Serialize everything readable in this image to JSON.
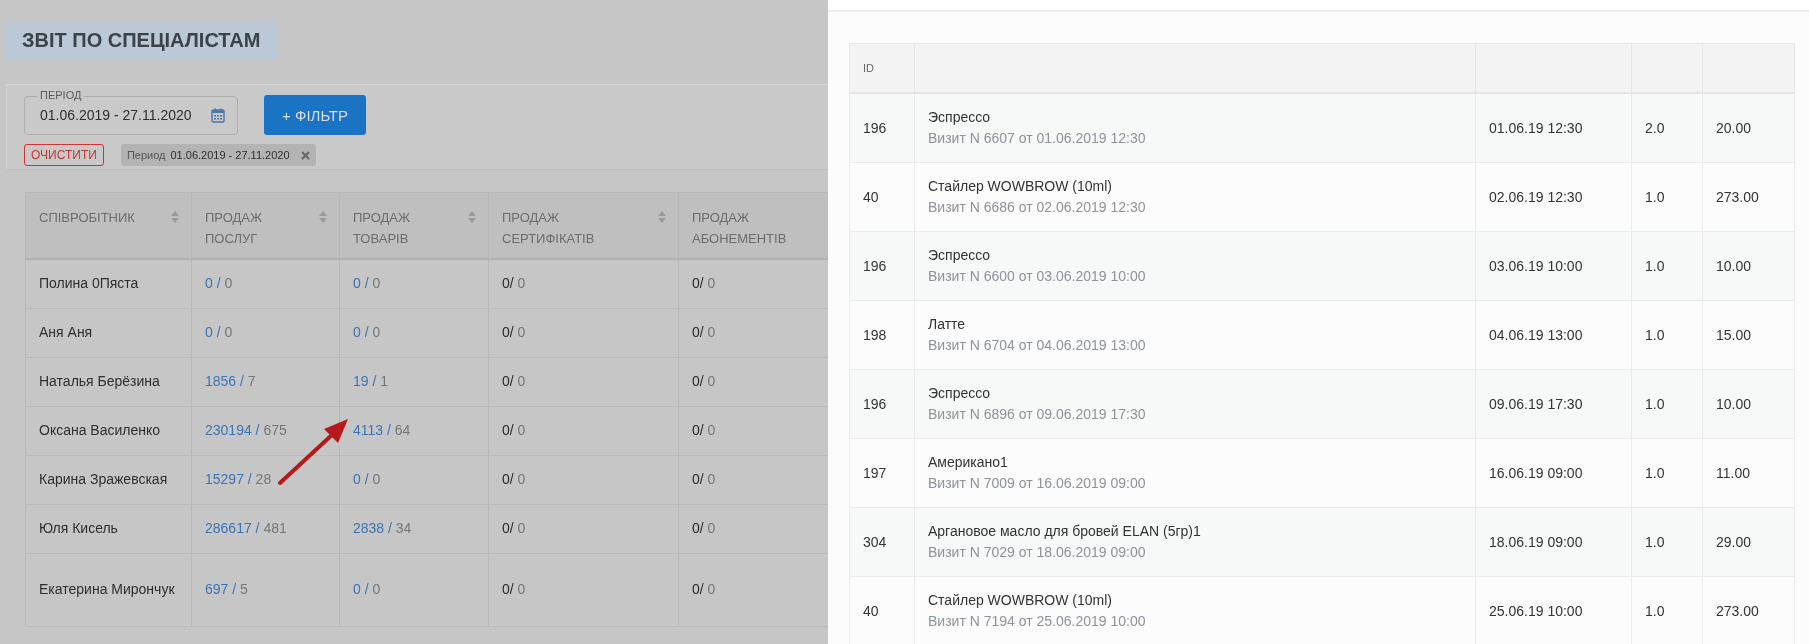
{
  "page_title": "ЗВІТ ПО СПЕЦІАЛІСТАМ",
  "period_field": {
    "label": "ПЕРІОД",
    "value": "01.06.2019 - 27.11.2020"
  },
  "filter_button": "+ ФІЛЬТР",
  "clear_button": "ОЧИСТИТИ",
  "filter_chip": {
    "label": "Период",
    "value": "01.06.2019 - 27.11.2020"
  },
  "report_table": {
    "columns": [
      {
        "label": "СПІВРОБІТНИК",
        "sortable": true
      },
      {
        "label": "ПРОДАЖ ПОСЛУГ",
        "sortable": true
      },
      {
        "label": "ПРОДАЖ ТОВАРІВ",
        "sortable": true
      },
      {
        "label": "ПРОДАЖ СЕРТИФІКАТІВ",
        "sortable": true
      },
      {
        "label": "ПРОДАЖ АБОНЕМЕНТІВ",
        "sortable": false
      }
    ],
    "rows": [
      {
        "cells": [
          {
            "kind": "name",
            "main": "Полина 0Пяста"
          },
          {
            "kind": "link",
            "main": "0 /",
            "count": "0"
          },
          {
            "kind": "link",
            "main": "0 /",
            "count": "0"
          },
          {
            "kind": "plain",
            "main": "0/",
            "count": "0"
          },
          {
            "kind": "plain",
            "main": "0/",
            "count": "0"
          }
        ]
      },
      {
        "cells": [
          {
            "kind": "name",
            "main": "Аня Аня"
          },
          {
            "kind": "link",
            "main": "0 /",
            "count": "0"
          },
          {
            "kind": "link",
            "main": "0 /",
            "count": "0"
          },
          {
            "kind": "plain",
            "main": "0/",
            "count": "0"
          },
          {
            "kind": "plain",
            "main": "0/",
            "count": "0"
          }
        ]
      },
      {
        "cells": [
          {
            "kind": "name",
            "main": "Наталья Берёзина"
          },
          {
            "kind": "link",
            "main": "1856 /",
            "count": "7"
          },
          {
            "kind": "link",
            "main": "19 /",
            "count": "1"
          },
          {
            "kind": "plain",
            "main": "0/",
            "count": "0"
          },
          {
            "kind": "plain",
            "main": "0/",
            "count": "0"
          }
        ]
      },
      {
        "cells": [
          {
            "kind": "name",
            "main": "Оксана Василенко"
          },
          {
            "kind": "link",
            "main": "230194 /",
            "count": "675"
          },
          {
            "kind": "link",
            "main": "4113 /",
            "count": "64"
          },
          {
            "kind": "plain",
            "main": "0/",
            "count": "0"
          },
          {
            "kind": "plain",
            "main": "0/",
            "count": "0"
          }
        ]
      },
      {
        "cells": [
          {
            "kind": "name",
            "main": "Карина Зражевская"
          },
          {
            "kind": "link",
            "main": "15297 /",
            "count": "28"
          },
          {
            "kind": "link",
            "main": "0 /",
            "count": "0"
          },
          {
            "kind": "plain",
            "main": "0/",
            "count": "0"
          },
          {
            "kind": "plain",
            "main": "0/",
            "count": "0"
          }
        ]
      },
      {
        "cells": [
          {
            "kind": "name",
            "main": "Юля Кисель"
          },
          {
            "kind": "link",
            "main": "286617 /",
            "count": "481"
          },
          {
            "kind": "link",
            "main": "2838 /",
            "count": "34"
          },
          {
            "kind": "plain",
            "main": "0/",
            "count": "0"
          },
          {
            "kind": "plain",
            "main": "0/",
            "count": "0"
          }
        ]
      },
      {
        "cells": [
          {
            "kind": "name",
            "main": "Екатерина Мирончук"
          },
          {
            "kind": "link",
            "main": "697 /",
            "count": "5"
          },
          {
            "kind": "link",
            "main": "0 /",
            "count": "0"
          },
          {
            "kind": "plain",
            "main": "0/",
            "count": "0"
          },
          {
            "kind": "plain",
            "main": "0/",
            "count": "0"
          }
        ]
      }
    ]
  },
  "drawer_table": {
    "columns": [
      "ID"
    ],
    "rows": [
      {
        "id": "196",
        "product": "Эспрессо",
        "visit": "Визит N 6607 от 01.06.2019 12:30",
        "date": "01.06.19 12:30",
        "qty": "2.0",
        "sum": "20.00"
      },
      {
        "id": "40",
        "product": "Стайлер WOWBROW (10ml)",
        "visit": "Визит N 6686 от 02.06.2019 12:30",
        "date": "02.06.19 12:30",
        "qty": "1.0",
        "sum": "273.00"
      },
      {
        "id": "196",
        "product": "Эспрессо",
        "visit": "Визит N 6600 от 03.06.2019 10:00",
        "date": "03.06.19 10:00",
        "qty": "1.0",
        "sum": "10.00"
      },
      {
        "id": "198",
        "product": "Латте",
        "visit": "Визит N 6704 от 04.06.2019 13:00",
        "date": "04.06.19 13:00",
        "qty": "1.0",
        "sum": "15.00"
      },
      {
        "id": "196",
        "product": "Эспрессо",
        "visit": "Визит N 6896 от 09.06.2019 17:30",
        "date": "09.06.19 17:30",
        "qty": "1.0",
        "sum": "10.00"
      },
      {
        "id": "197",
        "product": "Американо1",
        "visit": "Визит N 7009 от 16.06.2019 09:00",
        "date": "16.06.19 09:00",
        "qty": "1.0",
        "sum": "11.00"
      },
      {
        "id": "304",
        "product": "Аргановое масло для бровей ELAN (5гр)1",
        "visit": "Визит N 7029 от 18.06.2019 09:00",
        "date": "18.06.19 09:00",
        "qty": "1.0",
        "sum": "29.00"
      },
      {
        "id": "40",
        "product": "Стайлер WOWBROW (10ml)",
        "visit": "Визит N 7194 от 25.06.2019 10:00",
        "date": "25.06.19 10:00",
        "qty": "1.0",
        "sum": "273.00"
      }
    ]
  }
}
